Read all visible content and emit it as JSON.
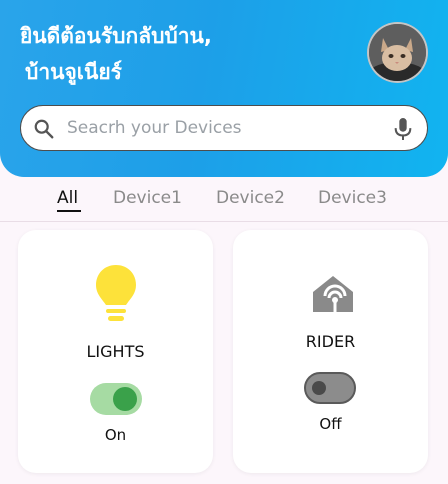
{
  "header": {
    "greeting_line1": "ยินดีต้อนรับกลับบ้าน,",
    "greeting_line2": "บ้านจูเนียร์",
    "gradient_colors": [
      "#2aa4ea",
      "#11b4f0"
    ]
  },
  "search": {
    "placeholder": "Seacrh your Devices",
    "value": ""
  },
  "tabs": [
    {
      "label": "All",
      "active": true
    },
    {
      "label": "Device1",
      "active": false
    },
    {
      "label": "Device2",
      "active": false
    },
    {
      "label": "Device3",
      "active": false
    }
  ],
  "devices": [
    {
      "name": "LIGHTS",
      "status": "On",
      "is_on": true,
      "icon": "lightbulb-icon",
      "icon_color": "#fde23a"
    },
    {
      "name": "RIDER",
      "status": "Off",
      "is_on": false,
      "icon": "smart-home-icon",
      "icon_color": "#8a8a8a"
    }
  ],
  "colors": {
    "toggle_on_track": "#a6dba3",
    "toggle_on_knob": "#3aa14a",
    "toggle_off_track": "#8c8c8c",
    "toggle_off_knob": "#4a4a4a"
  }
}
